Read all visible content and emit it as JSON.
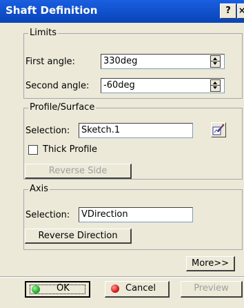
{
  "window": {
    "title": "Shaft Definition",
    "help_label": "?",
    "close_label": "×"
  },
  "limits": {
    "legend": "Limits",
    "first_angle_label": "First angle:",
    "first_angle_value": "330deg",
    "second_angle_label": "Second angle:",
    "second_angle_value": "-60deg"
  },
  "profile": {
    "legend": "Profile/Surface",
    "selection_label": "Selection:",
    "selection_value": "Sketch.1",
    "thick_profile_label": "Thick Profile",
    "thick_profile_checked": false,
    "reverse_side_label": "Reverse Side"
  },
  "axis": {
    "legend": "Axis",
    "selection_label": "Selection:",
    "selection_value": "VDirection",
    "reverse_direction_label": "Reverse Direction"
  },
  "buttons": {
    "more_label": "More>>",
    "ok_label": "OK",
    "cancel_label": "Cancel",
    "preview_label": "Preview"
  },
  "colors": {
    "titlebar": "#0a4bd3",
    "ok_icon": "#1fae2a",
    "cancel_icon": "#d81818",
    "dialog_bg": "#ece9d8"
  }
}
